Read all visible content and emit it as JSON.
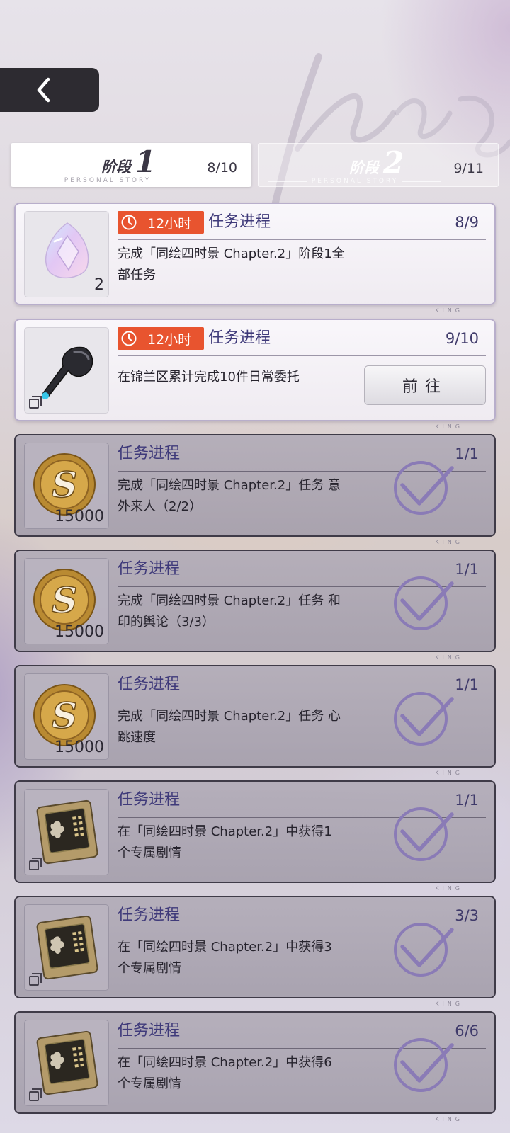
{
  "header": {
    "back_icon": "chevron-left-icon"
  },
  "stages": [
    {
      "label": "阶段",
      "number": "1",
      "subtitle": "PERSONAL STORY",
      "count": "8/10",
      "active": true
    },
    {
      "label": "阶段",
      "number": "2",
      "subtitle": "PERSONAL STORY",
      "count": "9/11",
      "active": false
    }
  ],
  "tasks": [
    {
      "status": "active",
      "timer": "12小时",
      "timer_icon": "clock-icon",
      "label": "任务进程",
      "progress": "8/9",
      "description": "完成「同绘四时景 Chapter.2」阶段1全部任务",
      "reward_icon": "crystal-icon",
      "reward_qty": "2"
    },
    {
      "status": "active",
      "timer": "12小时",
      "timer_icon": "clock-icon",
      "label": "任务进程",
      "progress": "9/10",
      "description": "在锦兰区累计完成10件日常委托",
      "reward_icon": "earbud-icon",
      "reward_qty": "",
      "button": "前往"
    },
    {
      "status": "done",
      "label": "任务进程",
      "progress": "1/1",
      "description": "完成「同绘四时景 Chapter.2」任务 意外来人（2/2）",
      "reward_icon": "coin-icon",
      "reward_qty": "15000"
    },
    {
      "status": "done",
      "label": "任务进程",
      "progress": "1/1",
      "description": "完成「同绘四时景 Chapter.2」任务 和印的舆论（3/3）",
      "reward_icon": "coin-icon",
      "reward_qty": "15000"
    },
    {
      "status": "done",
      "label": "任务进程",
      "progress": "1/1",
      "description": "完成「同绘四时景 Chapter.2」任务 心跳速度",
      "reward_icon": "coin-icon",
      "reward_qty": "15000"
    },
    {
      "status": "done",
      "label": "任务进程",
      "progress": "1/1",
      "description": "在「同绘四时景 Chapter.2」中获得1个专属剧情",
      "reward_icon": "memory-chip-icon",
      "reward_qty": ""
    },
    {
      "status": "done",
      "label": "任务进程",
      "progress": "3/3",
      "description": "在「同绘四时景 Chapter.2」中获得3个专属剧情",
      "reward_icon": "memory-chip-icon",
      "reward_qty": ""
    },
    {
      "status": "done",
      "label": "任务进程",
      "progress": "6/6",
      "description": "在「同绘四时景 Chapter.2」中获得6个专属剧情",
      "reward_icon": "memory-chip-icon",
      "reward_qty": ""
    }
  ]
}
